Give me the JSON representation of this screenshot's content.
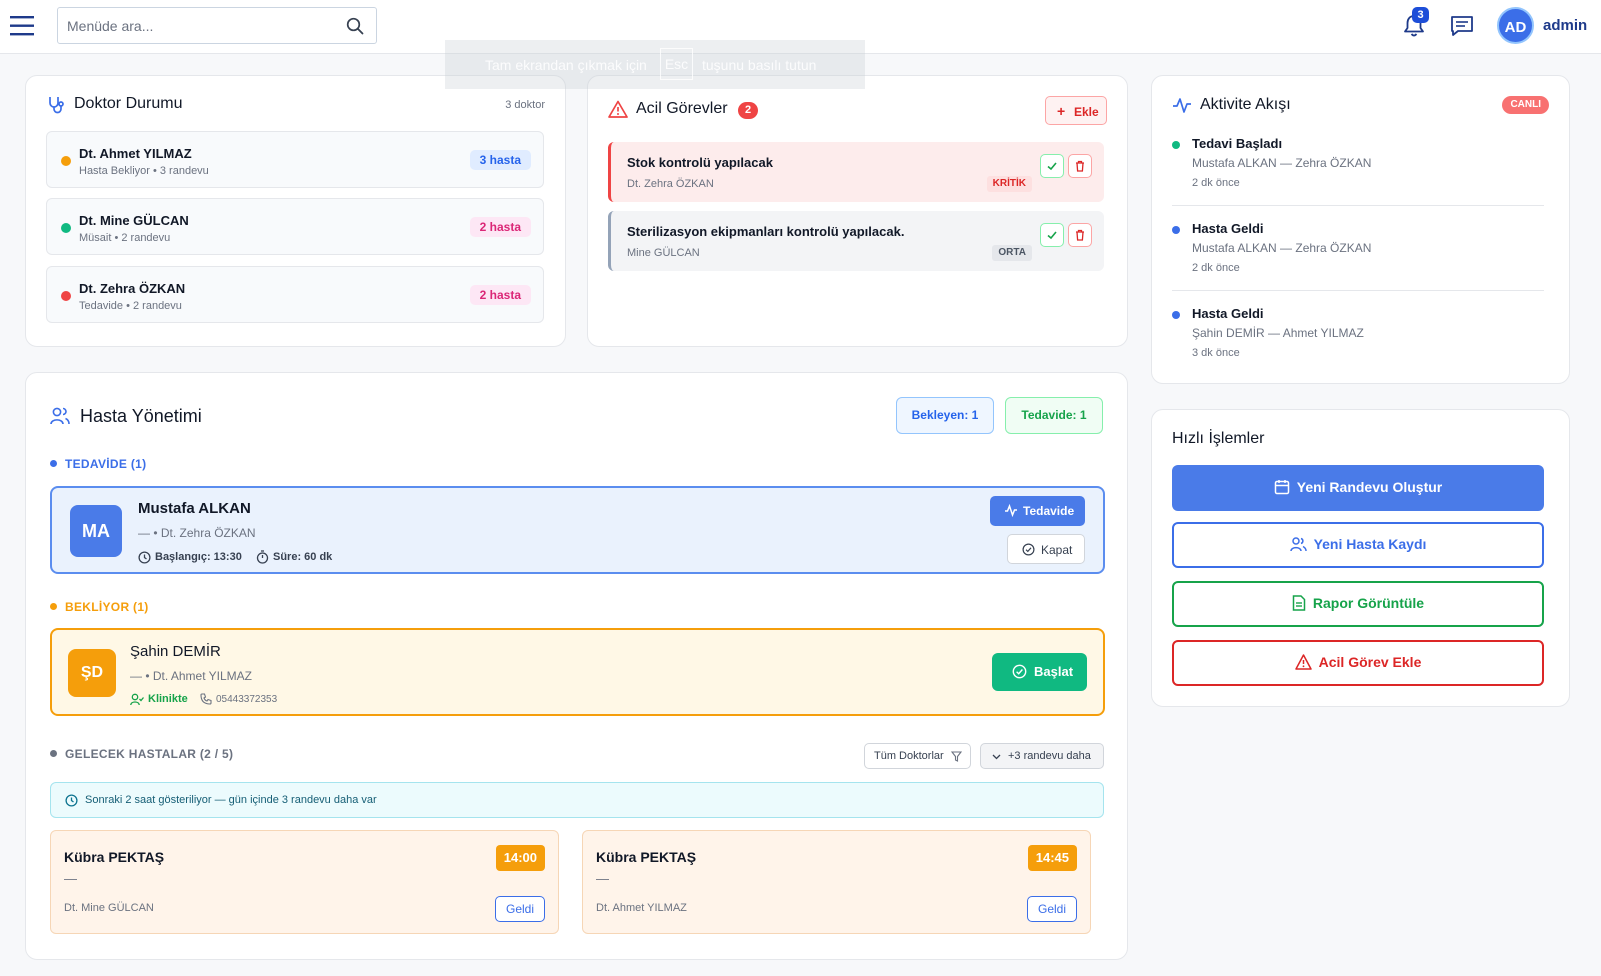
{
  "header": {
    "search_placeholder": "Menüde ara...",
    "notification_count": "3",
    "avatar_initials": "AD",
    "username": "admin"
  },
  "toast": {
    "before": "Tam ekrandan çıkmak için",
    "key": "Esc",
    "after": "tuşunu basılı tutun"
  },
  "doctors": {
    "title": "Doktor Durumu",
    "count": "3 doktor",
    "items": [
      {
        "name": "Dt. Ahmet YILMAZ",
        "status": "Hasta Bekliyor • 3 randevu",
        "pill": "3 hasta",
        "dot_color": "#f59e0b",
        "pill_bg": "#e0ecff",
        "pill_color": "#2563eb"
      },
      {
        "name": "Dt. Mine GÜLCAN",
        "status": "Müsait • 2 randevu",
        "pill": "2 hasta",
        "dot_color": "#10b981",
        "pill_bg": "#fde7f5",
        "pill_color": "#db2777"
      },
      {
        "name": "Dt. Zehra ÖZKAN",
        "status": "Tedavide • 2 randevu",
        "pill": "2 hasta",
        "dot_color": "#ef4444",
        "pill_bg": "#fde7f5",
        "pill_color": "#db2777"
      }
    ]
  },
  "tasks": {
    "title": "Acil Görevler",
    "count": "2",
    "add_label": "Ekle",
    "items": [
      {
        "title": "Stok kontrolü yapılacak",
        "who": "Dt. Zehra ÖZKAN",
        "tag": "KRİTİK"
      },
      {
        "title": "Sterilizasyon ekipmanları kontrolü yapılacak.",
        "who": "Mine GÜLCAN",
        "tag": "ORTA"
      }
    ]
  },
  "activity": {
    "title": "Aktivite Akışı",
    "live": "CANLI",
    "items": [
      {
        "title": "Tedavi Başladı",
        "desc": "Mustafa ALKAN — Zehra ÖZKAN",
        "time": "2 dk önce",
        "dot_color": "#10b981"
      },
      {
        "title": "Hasta Geldi",
        "desc": "Mustafa ALKAN — Zehra ÖZKAN",
        "time": "2 dk önce",
        "dot_color": "#3b6ee8"
      },
      {
        "title": "Hasta Geldi",
        "desc": "Şahin DEMİR — Ahmet YILMAZ",
        "time": "3 dk önce",
        "dot_color": "#3b6ee8"
      }
    ]
  },
  "quick": {
    "title": "Hızlı İşlemler",
    "new_appointment": "Yeni Randevu Oluştur",
    "new_patient": "Yeni Hasta Kaydı",
    "report": "Rapor Görüntüle",
    "urgent": "Acil Görev Ekle"
  },
  "patients": {
    "title": "Hasta Yönetimi",
    "waiting_badge": "Bekleyen: 1",
    "treating_badge": "Tedavide: 1",
    "treating_label": "TEDAVİDE (1)",
    "treating": {
      "initials": "MA",
      "name": "Mustafa ALKAN",
      "doctor": "— • Dt. Zehra ÖZKAN",
      "start": "Başlangıç: 13:30",
      "duration": "Süre: 60 dk",
      "status_btn": "Tedavide",
      "close_btn": "Kapat"
    },
    "waiting_label": "BEKLİYOR (1)",
    "waiting": {
      "initials": "ŞD",
      "name": "Şahin DEMİR",
      "doctor": "— • Dt. Ahmet YILMAZ",
      "location": "Klinikte",
      "phone": "05443372353",
      "start_btn": "Başlat"
    },
    "upcoming_label": "GELECEK HASTALAR (2 / 5)",
    "doctor_filter": "Tüm Doktorlar",
    "more_btn": "+3 randevu daha",
    "info": "Sonraki 2 saat gösteriliyor — gün içinde 3 randevu daha var",
    "upcoming": [
      {
        "name": "Kübra PEKTAŞ",
        "dash": "—",
        "doctor": "Dt. Mine GÜLCAN",
        "time": "14:00",
        "btn": "Geldi"
      },
      {
        "name": "Kübra PEKTAŞ",
        "dash": "—",
        "doctor": "Dt. Ahmet YILMAZ",
        "time": "14:45",
        "btn": "Geldi"
      }
    ]
  }
}
